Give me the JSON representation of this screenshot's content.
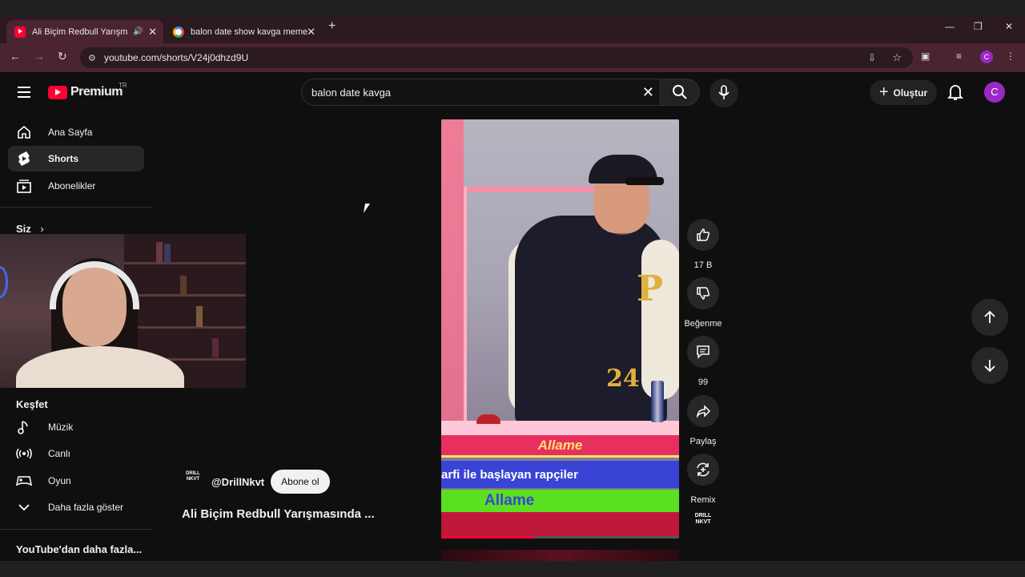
{
  "browser": {
    "tabs": [
      {
        "title": "Ali Biçim Redbull Yarışmasın",
        "active": true
      },
      {
        "title": "balon date show kavga meme",
        "active": false
      }
    ],
    "url": "youtube.com/shorts/V24j0dhzd9U",
    "profile_initial": "C"
  },
  "header": {
    "logo_text": "Premium",
    "country_code": "TR",
    "search_value": "balon date kavga",
    "create_label": "Oluştur",
    "avatar_initial": "C"
  },
  "sidebar": {
    "items": [
      {
        "label": "Ana Sayfa",
        "icon": "home-icon"
      },
      {
        "label": "Shorts",
        "icon": "shorts-icon",
        "selected": true
      },
      {
        "label": "Abonelikler",
        "icon": "subscriptions-icon"
      }
    ],
    "you_label": "Siz",
    "explore_title": "Keşfet",
    "explore_items": [
      {
        "label": "Müzik",
        "icon": "music-icon"
      },
      {
        "label": "Canlı",
        "icon": "live-icon"
      },
      {
        "label": "Oyun",
        "icon": "gaming-icon"
      },
      {
        "label": "Daha fazla göster",
        "icon": "chevron-down-icon"
      }
    ],
    "more_title": "YouTube'dan daha fazla..."
  },
  "video": {
    "overlay_top": "Allame",
    "overlay_mid": "arfi ile başlayan rapçiler",
    "overlay_bottom": "Allame",
    "progress": 0.39
  },
  "actions": {
    "like_count": "17 B",
    "dislike_label": "Beğenme",
    "comment_count": "99",
    "share_label": "Paylaş",
    "remix_label": "Remix"
  },
  "channel": {
    "logo_text": "DRILL NKVT",
    "handle": "@DrillNkvt",
    "subscribe_label": "Abone ol",
    "video_title": "Ali Biçim Redbull Yarışmasında ..."
  },
  "colors": {
    "brand_red": "#ff0033",
    "avatar_purple": "#9b27c6",
    "tab_bar": "#4a2430"
  }
}
